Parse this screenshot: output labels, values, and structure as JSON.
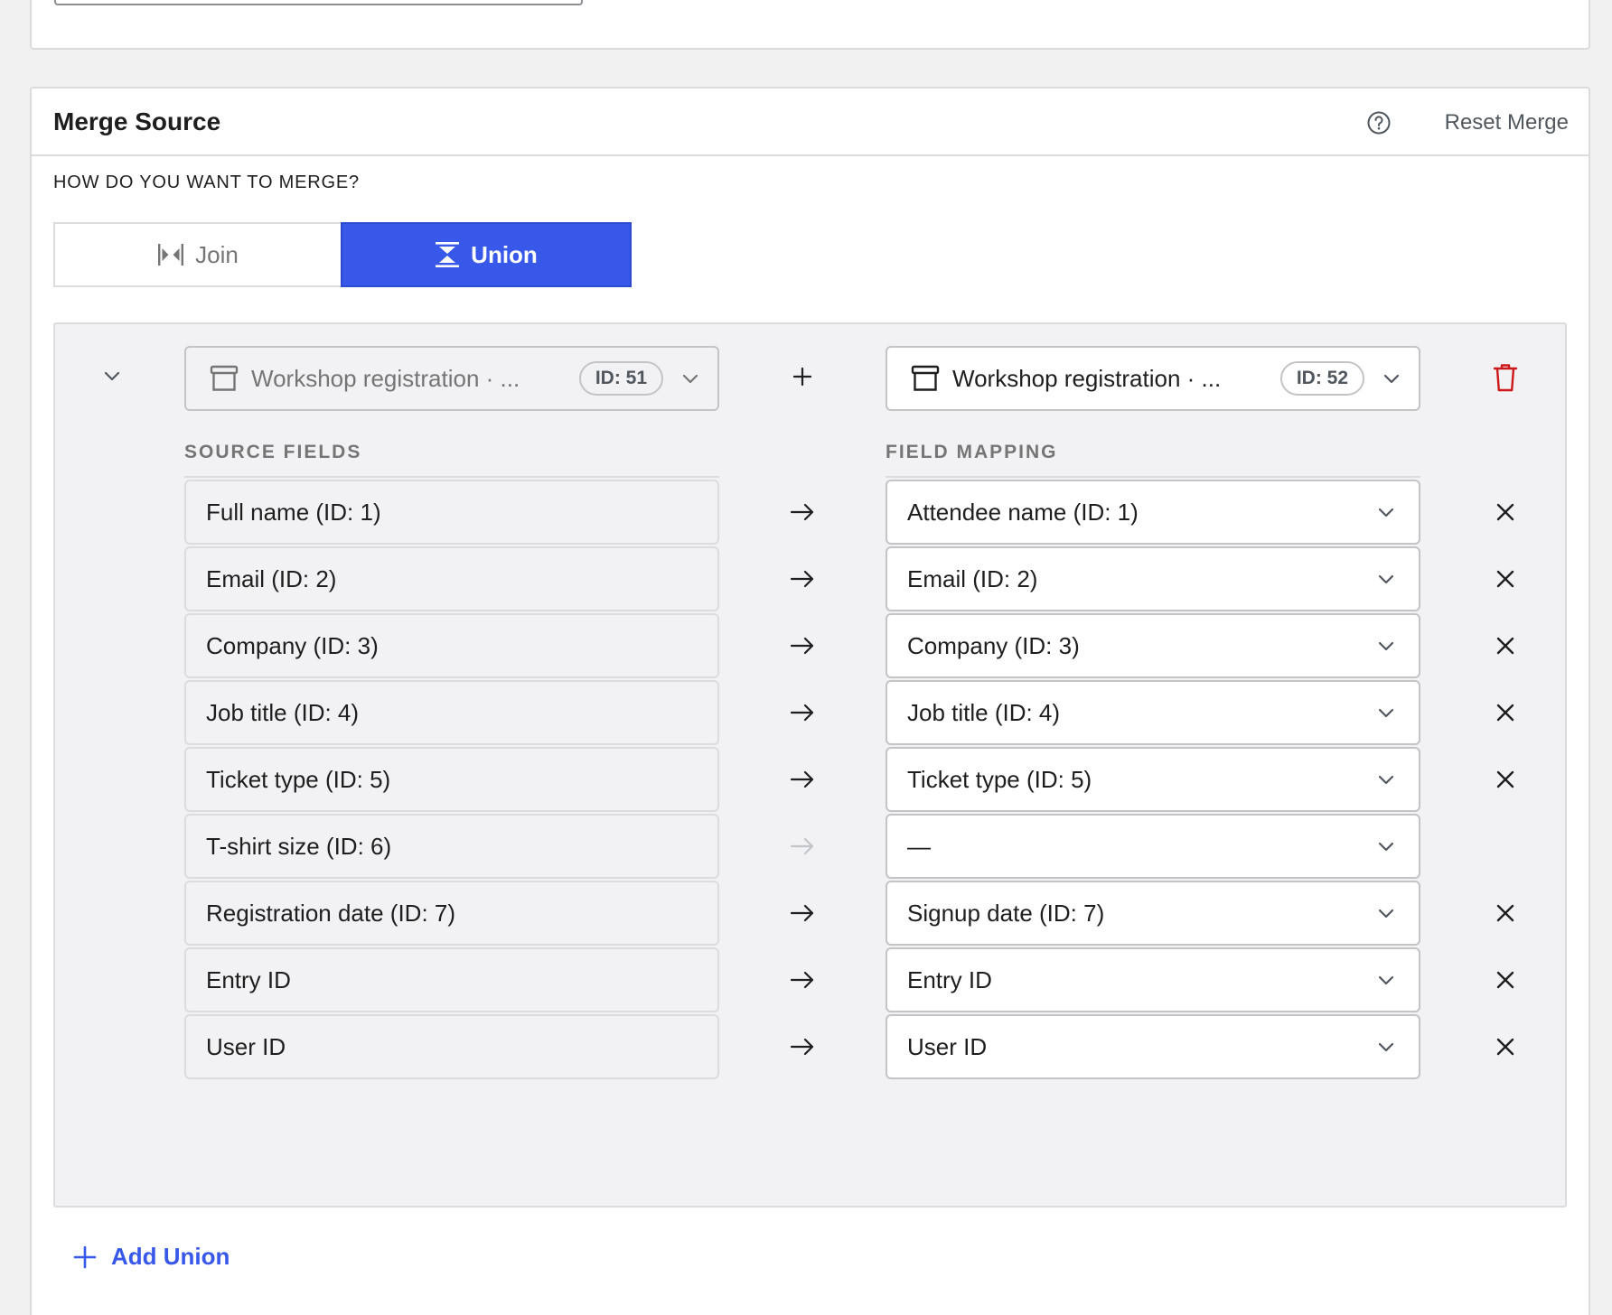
{
  "section": {
    "title": "Merge Source",
    "help_icon": "help-circle-icon",
    "reset_label": "Reset Merge",
    "question": "HOW DO YOU WANT TO MERGE?"
  },
  "merge_mode": {
    "join_label": "Join",
    "union_label": "Union",
    "selected": "Union"
  },
  "union": {
    "left_form": {
      "name": "Workshop registration · ...",
      "id_badge": "ID: 51"
    },
    "right_form": {
      "name": "Workshop registration · ...",
      "id_badge": "ID: 52"
    },
    "plus_symbol": "+",
    "source_fields_header": "SOURCE FIELDS",
    "field_mapping_header": "FIELD MAPPING",
    "rows": [
      {
        "source": "Full name (ID: 1)",
        "target": "Attendee name (ID: 1)",
        "mapped": true
      },
      {
        "source": "Email (ID: 2)",
        "target": "Email (ID: 2)",
        "mapped": true
      },
      {
        "source": "Company (ID: 3)",
        "target": "Company (ID: 3)",
        "mapped": true
      },
      {
        "source": "Job title (ID: 4)",
        "target": "Job title (ID: 4)",
        "mapped": true
      },
      {
        "source": "Ticket type (ID: 5)",
        "target": "Ticket type (ID: 5)",
        "mapped": true
      },
      {
        "source": "T-shirt size (ID: 6)",
        "target": "—",
        "mapped": false
      },
      {
        "source": "Registration date (ID: 7)",
        "target": "Signup date (ID: 7)",
        "mapped": true
      },
      {
        "source": "Entry ID",
        "target": "Entry ID",
        "mapped": true
      },
      {
        "source": "User ID",
        "target": "User ID",
        "mapped": true
      }
    ]
  },
  "add_union_label": "Add Union",
  "colors": {
    "accent": "#3858e9",
    "danger": "#cc1818",
    "muted": "#757575"
  }
}
